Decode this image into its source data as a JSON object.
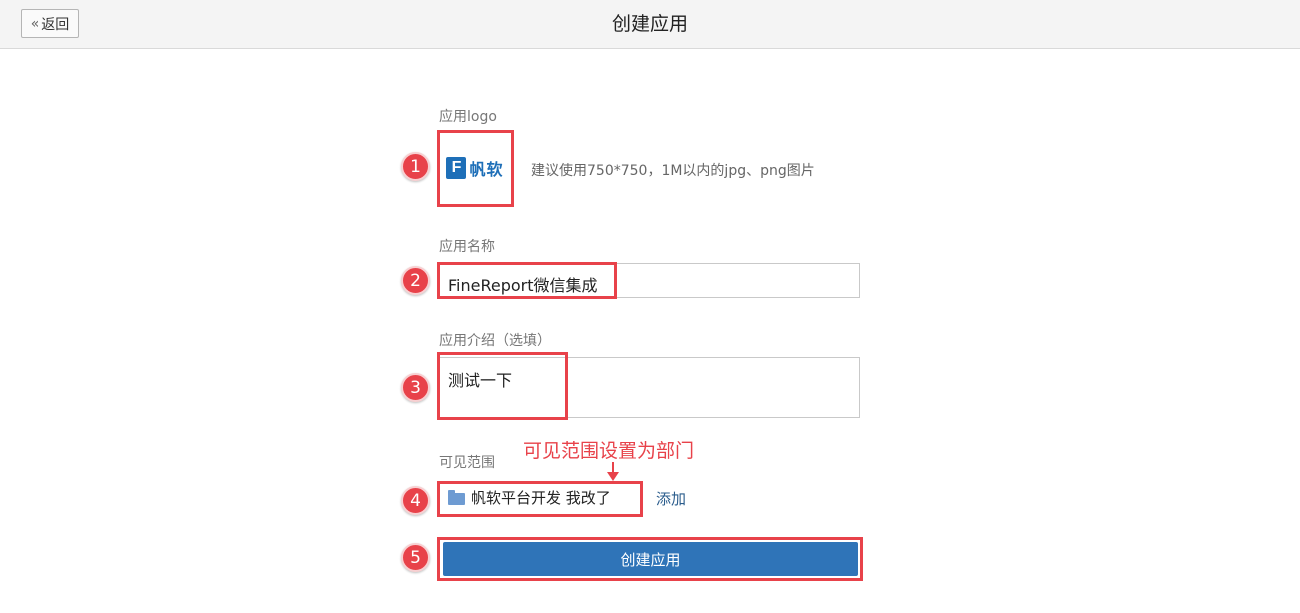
{
  "header": {
    "back_chevron": "«",
    "back_label": "返回",
    "title": "创建应用"
  },
  "form": {
    "logo": {
      "label": "应用logo",
      "logo_glyph": "F",
      "logo_text": "帆软",
      "hint": "建议使用750*750，1M以内的jpg、png图片"
    },
    "name": {
      "label": "应用名称",
      "value": "FineReport微信集成"
    },
    "intro": {
      "label": "应用介绍（选填）",
      "value": "测试一下"
    },
    "scope": {
      "label": "可见范围",
      "item": "帆软平台开发 我改了",
      "add_label": "添加"
    },
    "submit_label": "创建应用"
  },
  "annotations": {
    "steps": [
      "1",
      "2",
      "3",
      "4",
      "5"
    ],
    "scope_note": "可见范围设置为部门",
    "highlight_color": "#e8424a"
  },
  "colors": {
    "primary_button": "#2f74b8",
    "link": "#2a5c8c",
    "brand": "#1e6fb8"
  }
}
